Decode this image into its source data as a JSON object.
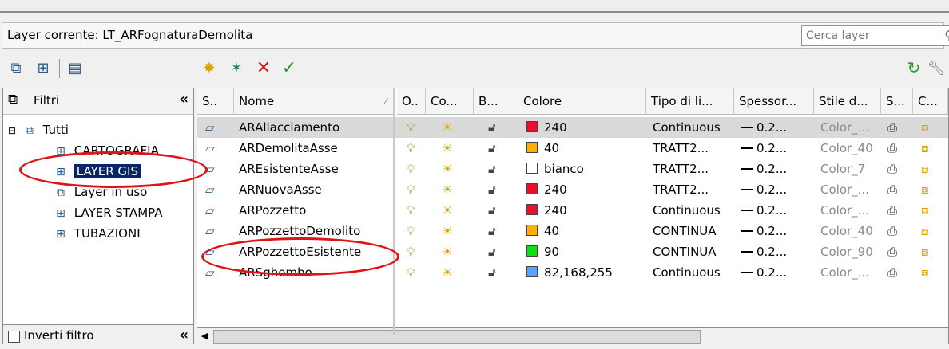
{
  "current_layer": "Layer corrente: LT_ARFognaturaDemolita",
  "search": {
    "placeholder": "Cerca layer"
  },
  "filters": {
    "title": "Filtri",
    "root": "Tutti",
    "items": [
      {
        "label": "CARTOGRAFIA",
        "icon": "layer-group-icon"
      },
      {
        "label": "LAYER GIS",
        "icon": "layer-group-icon",
        "selected": true
      },
      {
        "label": "Layer in uso",
        "icon": "layer-filter-icon"
      },
      {
        "label": "LAYER STAMPA",
        "icon": "layer-group-icon"
      },
      {
        "label": "TUBAZIONI",
        "icon": "layer-group-icon"
      }
    ],
    "invert_label": "Inverti filtro"
  },
  "columns": [
    "S..",
    "Nome",
    "O..",
    "Co...",
    "B...",
    "Colore",
    "Tipo di li...",
    "Spessor...",
    "Stile d...",
    "S...",
    "C..."
  ],
  "layers": [
    {
      "name": "ARAllacciamento",
      "color": "240",
      "swatch": "#e8102a",
      "linetype": "Continuous",
      "weight": "0.2...",
      "style": "Color_...",
      "selected": true
    },
    {
      "name": "ARDemolitaAsse",
      "color": "40",
      "swatch": "#ffb000",
      "linetype": "TRATT2...",
      "weight": "0.2...",
      "style": "Color_40"
    },
    {
      "name": "AREsistenteAsse",
      "color": "bianco",
      "swatch": "#ffffff",
      "linetype": "TRATT2...",
      "weight": "0.2...",
      "style": "Color_7"
    },
    {
      "name": "ARNuovaAsse",
      "color": "240",
      "swatch": "#e8102a",
      "linetype": "TRATT2...",
      "weight": "0.2...",
      "style": "Color_..."
    },
    {
      "name": "ARPozzetto",
      "color": "240",
      "swatch": "#e8102a",
      "linetype": "Continuous",
      "weight": "0.2...",
      "style": "Color_..."
    },
    {
      "name": "ARPozzettoDemolito",
      "color": "40",
      "swatch": "#ffb000",
      "linetype": "CONTINUA",
      "weight": "0.2...",
      "style": "Color_40"
    },
    {
      "name": "ARPozzettoEsistente",
      "color": "90",
      "swatch": "#11dd11",
      "linetype": "CONTINUA",
      "weight": "0.2...",
      "style": "Color_90"
    },
    {
      "name": "ARSghembo",
      "color": "82,168,255",
      "swatch": "#52a8ff",
      "linetype": "Continuous",
      "weight": "0.2...",
      "style": "Color_..."
    }
  ]
}
